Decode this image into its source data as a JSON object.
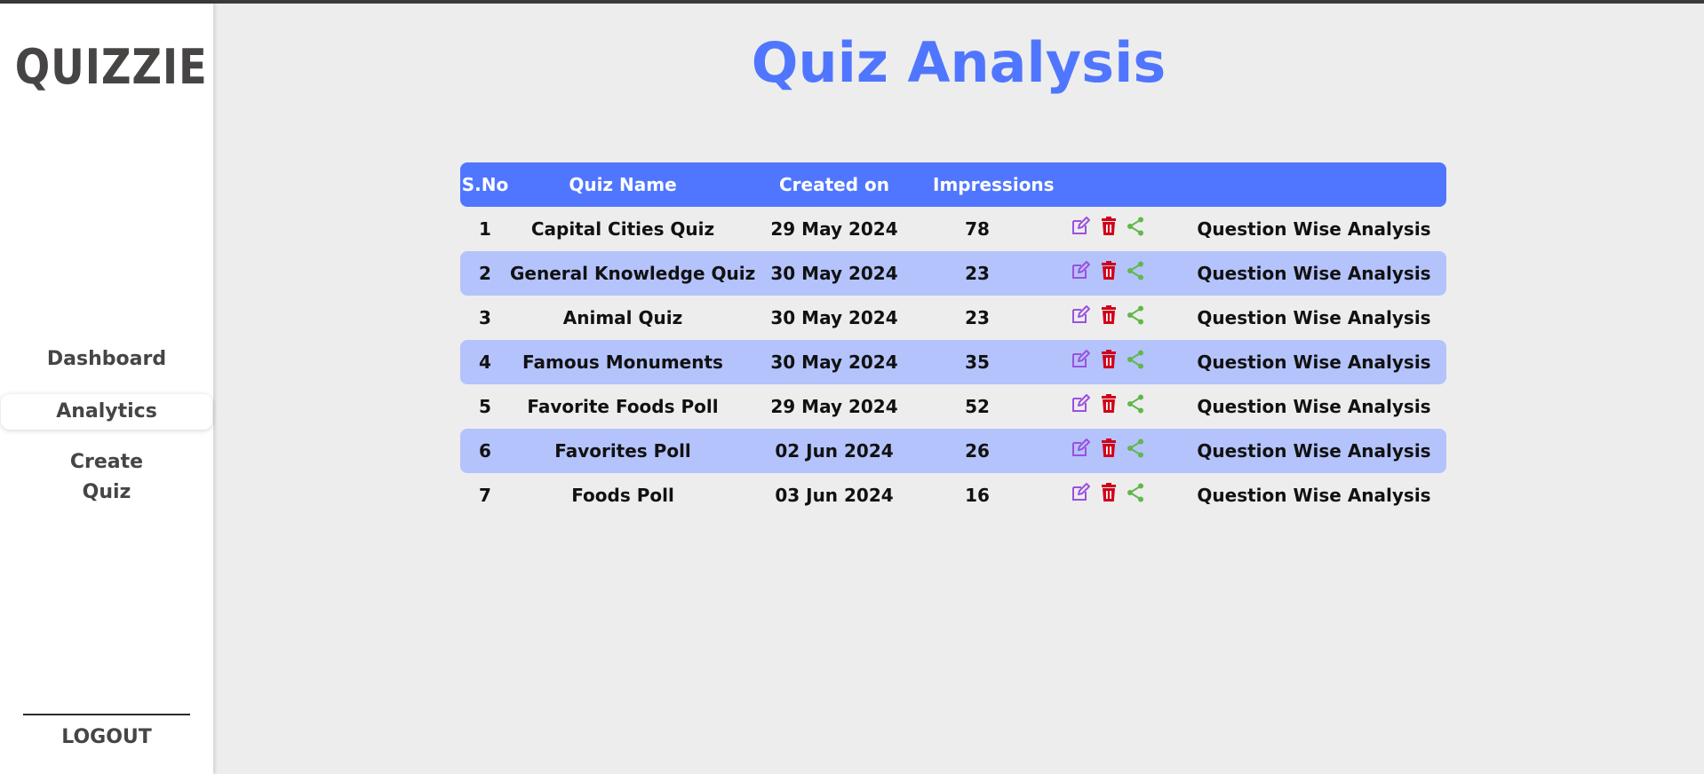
{
  "app": {
    "logo": "QUIZZIE"
  },
  "sidebar": {
    "items": [
      {
        "label": "Dashboard"
      },
      {
        "label": "Analytics"
      },
      {
        "label_line1": "Create",
        "label_line2": "Quiz"
      }
    ],
    "logout": "LOGOUT"
  },
  "page": {
    "title": "Quiz Analysis"
  },
  "table": {
    "headers": [
      "S.No",
      "Quiz Name",
      "Created on",
      "Impressions"
    ],
    "rows": [
      {
        "sno": "1",
        "name": "Capital Cities Quiz",
        "created": "29 May 2024",
        "impressions": "78",
        "link": "Question Wise Analysis"
      },
      {
        "sno": "2",
        "name": "General Knowledge Quiz",
        "created": "30 May 2024",
        "impressions": "23",
        "link": "Question Wise Analysis"
      },
      {
        "sno": "3",
        "name": "Animal Quiz",
        "created": "30 May 2024",
        "impressions": "23",
        "link": "Question Wise Analysis"
      },
      {
        "sno": "4",
        "name": "Famous Monuments",
        "created": "30 May 2024",
        "impressions": "35",
        "link": "Question Wise Analysis"
      },
      {
        "sno": "5",
        "name": "Favorite Foods Poll",
        "created": "29 May 2024",
        "impressions": "52",
        "link": "Question Wise Analysis"
      },
      {
        "sno": "6",
        "name": "Favorites Poll",
        "created": "02 Jun 2024",
        "impressions": "26",
        "link": "Question Wise Analysis"
      },
      {
        "sno": "7",
        "name": "Foods Poll",
        "created": "03 Jun 2024",
        "impressions": "16",
        "link": "Question Wise Analysis"
      }
    ],
    "actions": [
      "edit-icon",
      "delete-icon",
      "share-icon"
    ]
  },
  "colors": {
    "accent": "#5076ff",
    "row_highlight": "#b4c3fb",
    "edit": "#9b51e0",
    "delete": "#d0021b",
    "share": "#60b84a"
  }
}
